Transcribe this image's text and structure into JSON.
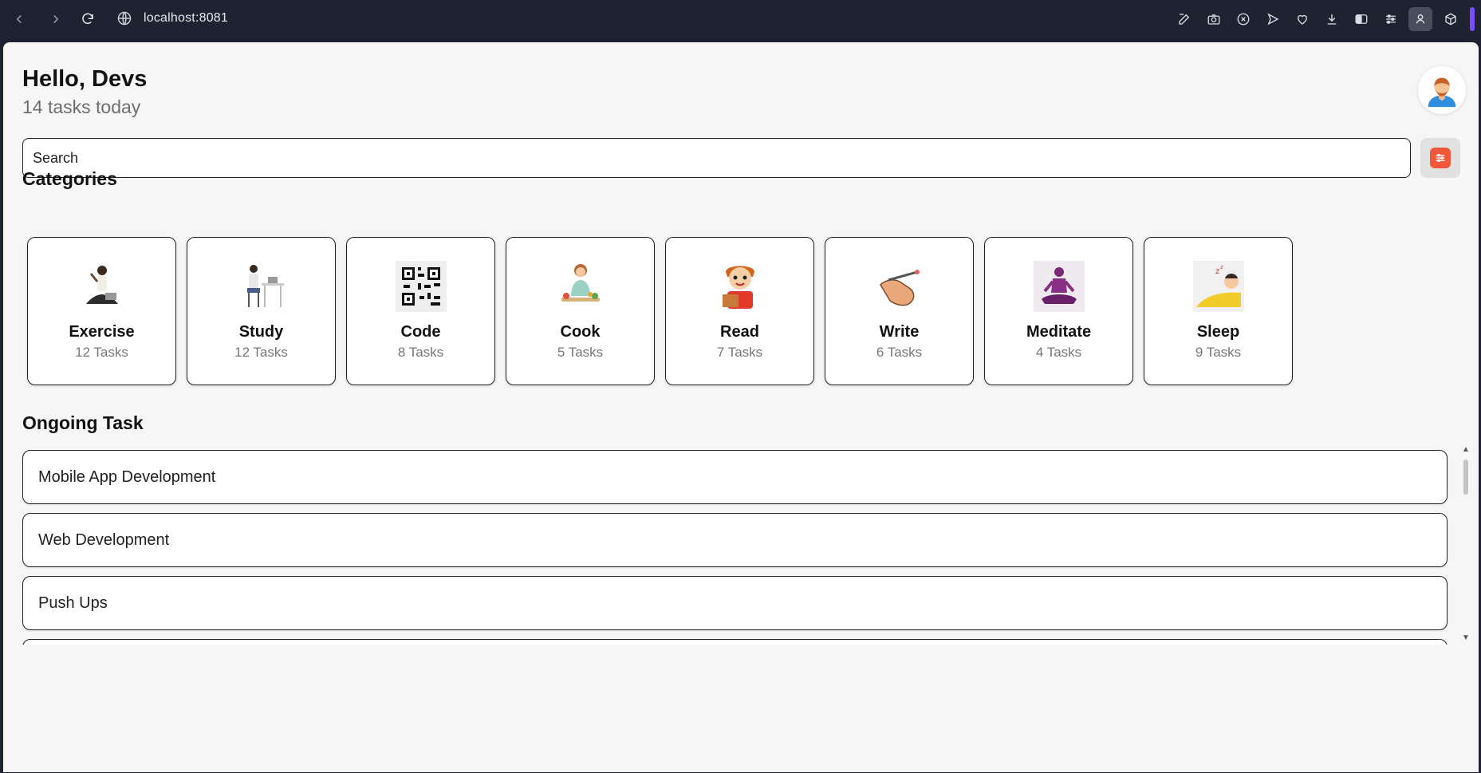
{
  "browser": {
    "url": "localhost:8081",
    "extensions": [
      "edit-icon",
      "camera-icon",
      "close-circle-icon",
      "send-icon",
      "heart-icon",
      "download-icon",
      "sidebar-icon",
      "tune-icon",
      "profile-icon",
      "cube-icon"
    ]
  },
  "header": {
    "greeting": "Hello, Devs",
    "subtitle": "14 tasks today"
  },
  "search": {
    "placeholder": "Search"
  },
  "colors": {
    "accent": "#f0573b",
    "background": "#f6f6f6",
    "chrome": "#1f2230"
  },
  "categories": {
    "title": "Categories",
    "items": [
      {
        "name": "Exercise",
        "count": "12 Tasks",
        "icon": "exercise-image"
      },
      {
        "name": "Study",
        "count": "12 Tasks",
        "icon": "study-image"
      },
      {
        "name": "Code",
        "count": "8 Tasks",
        "icon": "qr-code-image"
      },
      {
        "name": "Cook",
        "count": "5 Tasks",
        "icon": "cook-image"
      },
      {
        "name": "Read",
        "count": "7 Tasks",
        "icon": "read-image"
      },
      {
        "name": "Write",
        "count": "6 Tasks",
        "icon": "write-image"
      },
      {
        "name": "Meditate",
        "count": "4 Tasks",
        "icon": "meditate-image"
      },
      {
        "name": "Sleep",
        "count": "9 Tasks",
        "icon": "sleep-image"
      }
    ]
  },
  "ongoing": {
    "title": "Ongoing Task",
    "tasks": [
      {
        "name": "Mobile App Development"
      },
      {
        "name": "Web Development"
      },
      {
        "name": "Push Ups"
      },
      {
        "name": ""
      }
    ]
  }
}
